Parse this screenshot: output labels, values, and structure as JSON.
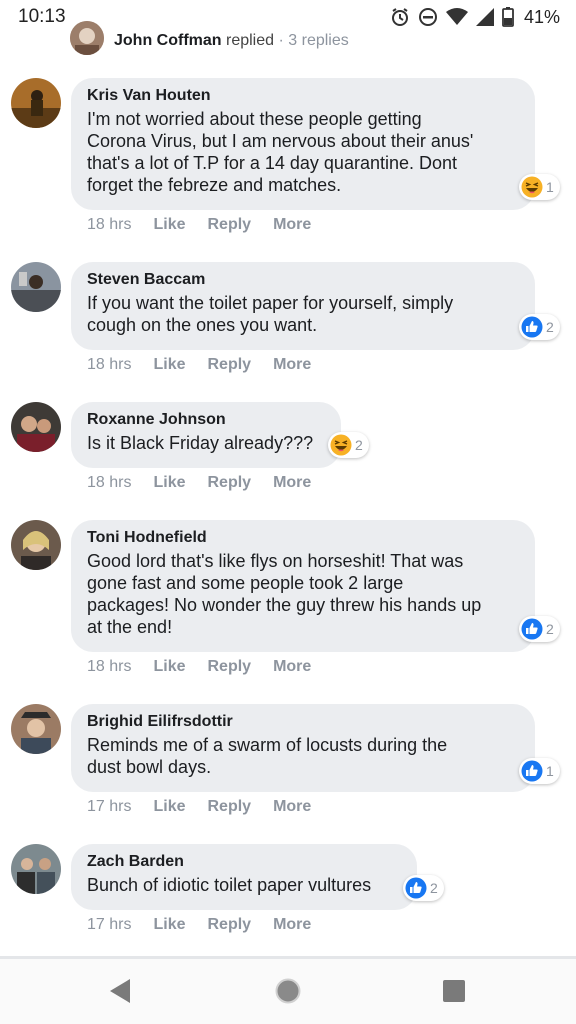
{
  "status": {
    "time": "10:13",
    "battery": "41%"
  },
  "prev_reply": {
    "name": "John Coffman",
    "action": "replied",
    "separator": "·",
    "count": "3 replies"
  },
  "comments": [
    {
      "author": "Kris Van Houten",
      "text": "I'm not worried about these people getting\nCorona Virus, but I am nervous about their anus'\nthat's a lot of T.P for a 14 day quarantine. Dont\nforget the febreze and matches.",
      "time": "18 hrs",
      "reaction": "haha",
      "reaction_count": "1"
    },
    {
      "author": "Steven Baccam",
      "text": "If you want the toilet paper for yourself, simply\ncough on the ones you want.",
      "time": "18 hrs",
      "reaction": "like",
      "reaction_count": "2"
    },
    {
      "author": "Roxanne Johnson",
      "text": "Is it Black Friday already???",
      "time": "18 hrs",
      "reaction": "haha",
      "reaction_count": "2"
    },
    {
      "author": "Toni Hodnefield",
      "text": "Good lord that's like flys on horseshit! That was\ngone fast and some people took 2 large\npackages! No wonder the guy threw his hands up\nat the end!",
      "time": "18 hrs",
      "reaction": "like",
      "reaction_count": "2"
    },
    {
      "author": "Brighid Eilifrsdottir",
      "text": "Reminds me of a swarm of locusts during the\ndust bowl days.",
      "time": "17 hrs",
      "reaction": "like",
      "reaction_count": "1"
    },
    {
      "author": "Zach Barden",
      "text": "Bunch of idiotic toilet paper vultures",
      "time": "17 hrs",
      "reaction": "like",
      "reaction_count": "2"
    }
  ],
  "actions": {
    "like": "Like",
    "reply": "Reply",
    "more": "More"
  },
  "colors": {
    "bubble": "#ebedf0",
    "like_blue": "#1877f2",
    "haha_yellow": "#f7b125",
    "meta_gray": "#8d949e"
  }
}
